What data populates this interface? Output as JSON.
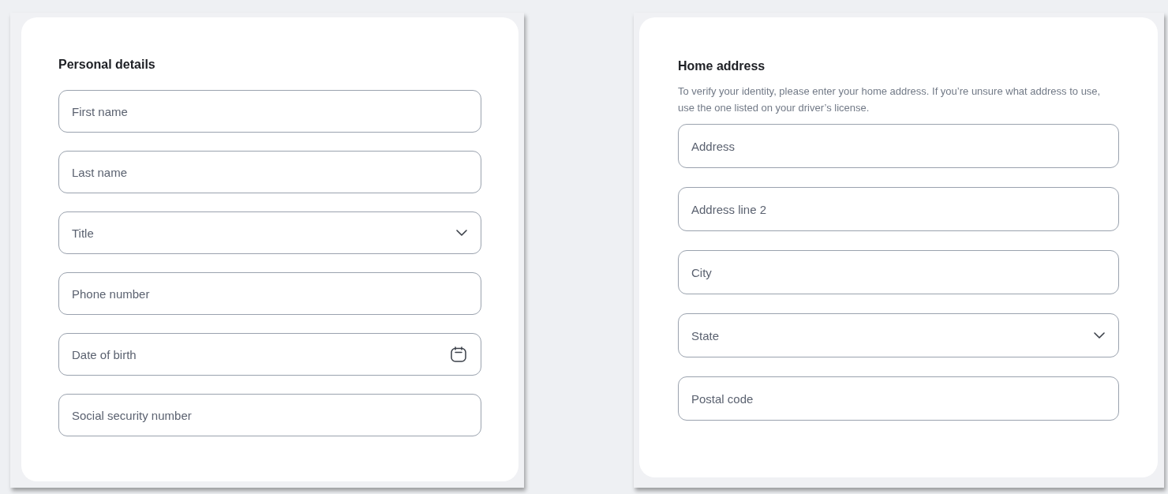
{
  "personal_details": {
    "title": "Personal details",
    "fields": [
      {
        "kind": "text",
        "placeholder": "First name"
      },
      {
        "kind": "text",
        "placeholder": "Last name"
      },
      {
        "kind": "select",
        "placeholder": "Title"
      },
      {
        "kind": "text",
        "placeholder": "Phone number"
      },
      {
        "kind": "date",
        "placeholder": "Date of birth"
      },
      {
        "kind": "text",
        "placeholder": "Social security number"
      }
    ]
  },
  "home_address": {
    "title": "Home address",
    "description": "To verify your identity, please enter your home address. If you’re unsure what address to use, use the one listed on your driver’s license.",
    "fields": [
      {
        "kind": "text",
        "placeholder": "Address"
      },
      {
        "kind": "text",
        "placeholder": "Address line 2"
      },
      {
        "kind": "text",
        "placeholder": "City"
      },
      {
        "kind": "select",
        "placeholder": "State"
      },
      {
        "kind": "text",
        "placeholder": "Postal code"
      }
    ]
  }
}
